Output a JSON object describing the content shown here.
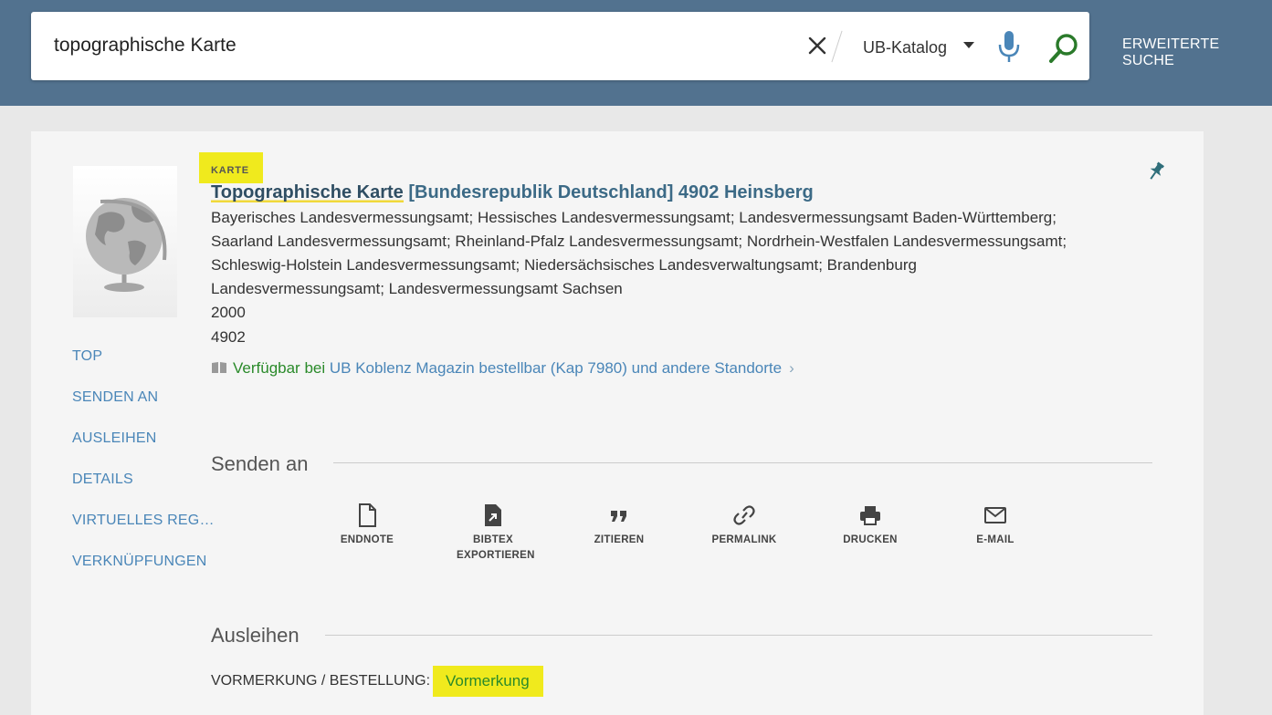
{
  "header": {
    "search_value": "topographische Karte",
    "scope": "UB-Katalog",
    "advanced_search": "ERWEITERTE SUCHE"
  },
  "side_nav": [
    {
      "label": "TOP"
    },
    {
      "label": "SENDEN AN"
    },
    {
      "label": "AUSLEIHEN"
    },
    {
      "label": "DETAILS"
    },
    {
      "label": "VIRTUELLES REG…"
    },
    {
      "label": "VERKNÜPFUNGEN"
    }
  ],
  "record": {
    "type": "KARTE",
    "title_main": "Topographische Karte",
    "title_rest": " [Bundesrepublik Deutschland] 4902 Heinsberg",
    "authors": [
      "Bayerisches Landesvermessungsamt; Hessisches Landesvermessungsamt; Landesvermessungsamt Baden-Württemberg;",
      "Saarland Landesvermessungsamt; Rheinland-Pfalz Landesvermessungsamt; Nordrhein-Westfalen Landesvermessungsamt;",
      "Schleswig-Holstein Landesvermessungsamt; Niedersächsisches Landesverwaltungsamt; Brandenburg",
      "Landesvermessungsamt; Landesvermessungsamt Sachsen"
    ],
    "year": "2000",
    "number": "4902",
    "availability": {
      "status": "Verfügbar bei",
      "library": "UB Koblenz",
      "location": "Magazin bestellbar (Kap 7980) und andere Standorte",
      "chevron": "›"
    }
  },
  "send_section": {
    "title": "Senden an",
    "actions": [
      {
        "label": "ENDNOTE",
        "icon": "document-icon"
      },
      {
        "label": "BIBTEX EXPORTIEREN",
        "icon": "export-file-icon"
      },
      {
        "label": "ZITIEREN",
        "icon": "quote-icon"
      },
      {
        "label": "PERMALINK",
        "icon": "link-icon"
      },
      {
        "label": "DRUCKEN",
        "icon": "printer-icon"
      },
      {
        "label": "E-MAIL",
        "icon": "mail-icon"
      }
    ]
  },
  "loan_section": {
    "title": "Ausleihen",
    "reserve_label": "VORMERKUNG / BESTELLUNG:",
    "reserve_button": "Vormerkung"
  },
  "colors": {
    "header_bg": "#52728f",
    "highlight": "#f0ea1d",
    "link": "#4a86b8",
    "available": "#2a8a2a"
  }
}
